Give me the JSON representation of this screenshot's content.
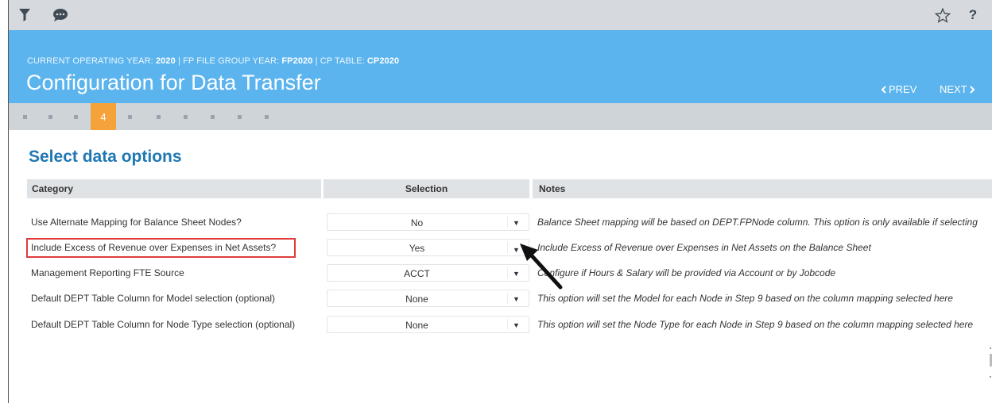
{
  "toolbar": {
    "icons": [
      "filter-icon",
      "chat-icon",
      "star-icon",
      "help-icon"
    ],
    "help_label": "?"
  },
  "header": {
    "context": {
      "operating_year_label": "CURRENT OPERATING YEAR:",
      "operating_year": "2020",
      "file_group_label": "| FP FILE GROUP YEAR:",
      "file_group": "FP2020",
      "cp_table_label": "| CP TABLE:",
      "cp_table": "CP2020"
    },
    "title": "Configuration for Data Transfer",
    "prev_label": "PREV",
    "next_label": "NEXT"
  },
  "steps": {
    "total": 10,
    "current": "4"
  },
  "section": {
    "title": "Select data options"
  },
  "table": {
    "columns": [
      "Category",
      "Selection",
      "Notes"
    ],
    "rows": [
      {
        "category": "Use Alternate Mapping for Balance Sheet Nodes?",
        "selection": "No",
        "note": "Balance Sheet mapping will be based on DEPT.FPNode column. This option is only available if selecting"
      },
      {
        "category": "Include Excess of Revenue over Expenses in Net Assets?",
        "selection": "Yes",
        "note": "Include Excess of Revenue over Expenses in Net Assets on the Balance Sheet"
      },
      {
        "category": "Management Reporting FTE Source",
        "selection": "ACCT",
        "note": "Configure if Hours & Salary will be provided via Account or by Jobcode"
      },
      {
        "category": "Default DEPT Table Column for Model selection (optional)",
        "selection": "None",
        "note": "This option will set the Model for each Node in Step 9 based on the column mapping selected here"
      },
      {
        "category": "Default DEPT Table Column for Node Type selection (optional)",
        "selection": "None",
        "note": "This option will set the Node Type for each Node in Step 9 based on the column mapping selected here"
      }
    ]
  },
  "annotations": {
    "highlight_color": "#e03c3c",
    "highlighted_row": "Include Excess of Revenue over Expenses in Net Assets?",
    "arrow_target": "selection-dropdown-arrow"
  },
  "colors": {
    "header_bg": "#5bb4ee",
    "toolbar_bg": "#d6dade",
    "stepbar_bg": "#cfd4d9",
    "active_step": "#f5a23a",
    "section_title": "#1f78b4"
  }
}
